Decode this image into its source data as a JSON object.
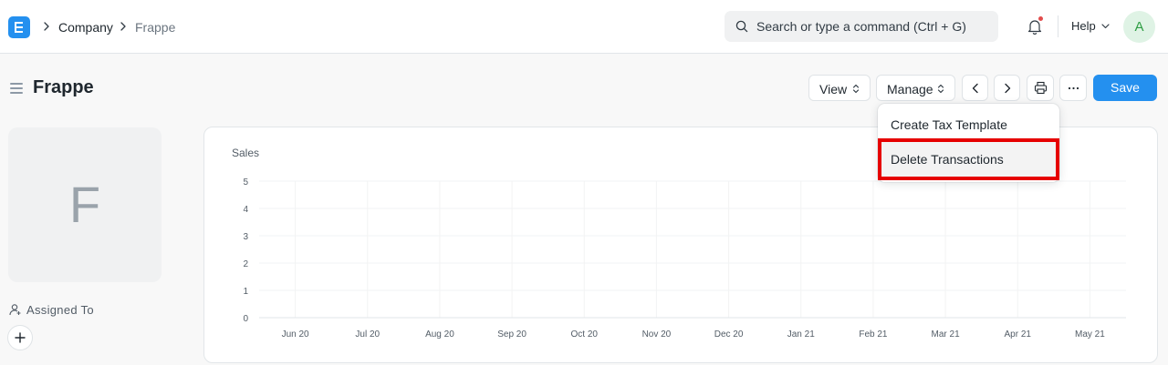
{
  "breadcrumb": {
    "items": [
      "Company",
      "Frappe"
    ]
  },
  "search": {
    "placeholder": "Search or type a command (Ctrl + G)"
  },
  "navbar": {
    "help_label": "Help",
    "avatar_initial": "A"
  },
  "page": {
    "title": "Frappe",
    "view_label": "View",
    "manage_label": "Manage",
    "save_label": "Save"
  },
  "manage_menu": {
    "items": [
      "Create Tax Template",
      "Delete Transactions"
    ],
    "highlighted_index": 1
  },
  "sidebar": {
    "image_initial": "F",
    "assigned_to_label": "Assigned To"
  },
  "chart_data": {
    "type": "line",
    "title": "Sales",
    "categories": [
      "Jun 20",
      "Jul 20",
      "Aug 20",
      "Sep 20",
      "Oct 20",
      "Nov 20",
      "Dec 20",
      "Jan 21",
      "Feb 21",
      "Mar 21",
      "Apr 21",
      "May 21"
    ],
    "series": [
      {
        "values": [
          0,
          0,
          0,
          0,
          0,
          0,
          0,
          0,
          0,
          0,
          0,
          0
        ]
      }
    ],
    "y_ticks": [
      "0",
      "1",
      "2",
      "3",
      "4",
      "5"
    ],
    "ylim": [
      0,
      5
    ],
    "grid": true
  },
  "colors": {
    "primary": "#2490ef",
    "highlight_border": "#e60000",
    "notification_dot": "#e24c4c",
    "avatar_bg": "#dff3e5",
    "avatar_fg": "#2f9e44"
  }
}
